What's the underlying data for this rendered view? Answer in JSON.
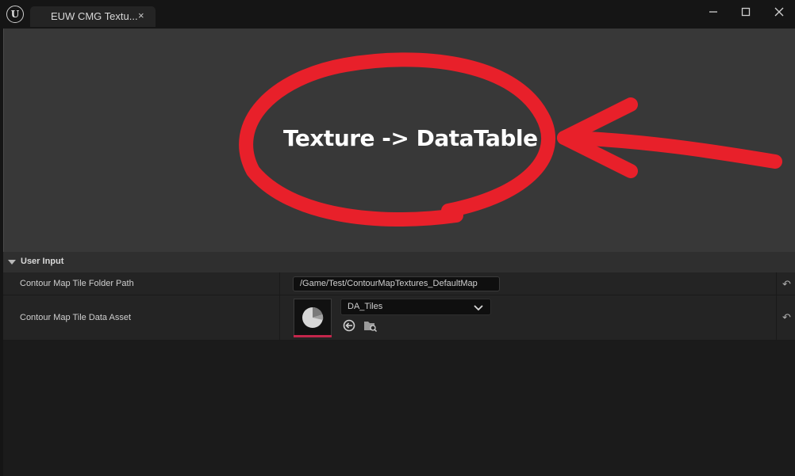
{
  "window": {
    "tab_title": "EUW CMG Textu...",
    "tab_close": "×",
    "minimize": "—",
    "maximize": "☐",
    "close": "✕"
  },
  "preview": {
    "label": "Texture -> DataTable",
    "annotation_color": "#e8202a"
  },
  "details": {
    "section_title": "User Input",
    "rows": [
      {
        "name": "Contour Map Tile Folder Path",
        "value": "/Game/Test/ContourMapTextures_DefaultMap"
      },
      {
        "name": "Contour Map Tile Data Asset",
        "value": "DA_Tiles"
      }
    ],
    "reset_icon": "↶"
  },
  "colors": {
    "background": "#151515",
    "panel": "#242424",
    "preview_bg": "#383838",
    "accent_bar": "#c3264b"
  },
  "icons": {
    "logo": "unreal-engine-logo",
    "asset_thumbnail": "data-asset-pie-icon",
    "use_selected": "use-selected-arrow-icon",
    "browse": "browse-folder-icon",
    "dropdown": "chevron-down-icon"
  }
}
